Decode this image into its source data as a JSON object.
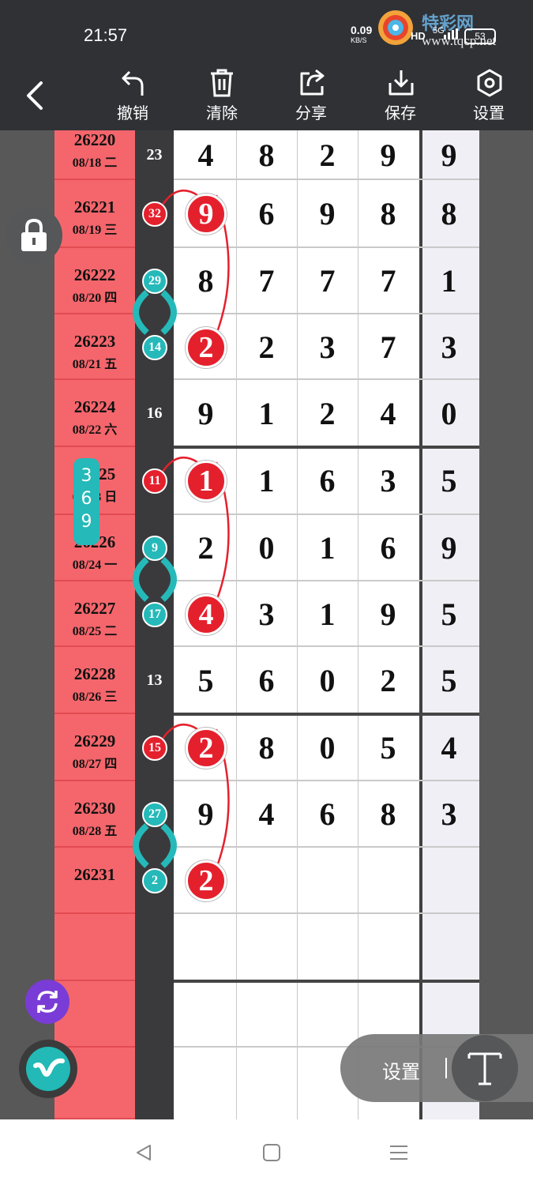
{
  "status_bar": {
    "time": "21:57",
    "net_speed": "0.09",
    "net_unit": "KB/S",
    "hd": "HD",
    "signal": "5G",
    "battery": "53",
    "watermark_text": "特彩网",
    "watermark_url": "www.tqcp.net"
  },
  "toolbar": {
    "back_icon": "back-arrow-icon",
    "tools": [
      {
        "label": "撤销",
        "icon": "undo-icon"
      },
      {
        "label": "清除",
        "icon": "trash-icon"
      },
      {
        "label": "分享",
        "icon": "share-icon"
      },
      {
        "label": "保存",
        "icon": "download-icon"
      },
      {
        "label": "设置",
        "icon": "hexagon-settings-icon"
      }
    ]
  },
  "rows": [
    {
      "id": "26220",
      "date": "08/18 二",
      "sum": "23",
      "digits": [
        "4",
        "8",
        "2",
        "9"
      ],
      "last": "9"
    },
    {
      "id": "26221",
      "date": "08/19 三",
      "sum": "32",
      "digits": [
        "9",
        "6",
        "9",
        "8"
      ],
      "last": "8"
    },
    {
      "id": "26222",
      "date": "08/20 四",
      "sum": "29",
      "digits": [
        "8",
        "7",
        "7",
        "7"
      ],
      "last": "1"
    },
    {
      "id": "26223",
      "date": "08/21 五",
      "sum": "14",
      "digits": [
        "2",
        "2",
        "3",
        "7"
      ],
      "last": "3"
    },
    {
      "id": "26224",
      "date": "08/22 六",
      "sum": "16",
      "digits": [
        "9",
        "1",
        "2",
        "4"
      ],
      "last": "0"
    },
    {
      "id": "26225",
      "date": "08/23 日",
      "sum": "11",
      "digits": [
        "1",
        "1",
        "6",
        "3"
      ],
      "last": "5"
    },
    {
      "id": "26226",
      "date": "08/24 一",
      "sum": "9",
      "digits": [
        "2",
        "0",
        "1",
        "6"
      ],
      "last": "9"
    },
    {
      "id": "26227",
      "date": "08/25 二",
      "sum": "17",
      "digits": [
        "4",
        "3",
        "1",
        "9"
      ],
      "last": "5"
    },
    {
      "id": "26228",
      "date": "08/26 三",
      "sum": "13",
      "digits": [
        "5",
        "6",
        "0",
        "2"
      ],
      "last": "5"
    },
    {
      "id": "26229",
      "date": "08/27 四",
      "sum": "15",
      "digits": [
        "2",
        "8",
        "0",
        "5"
      ],
      "last": "4"
    },
    {
      "id": "26230",
      "date": "08/28 五",
      "sum": "27",
      "digits": [
        "9",
        "4",
        "6",
        "8"
      ],
      "last": "3"
    },
    {
      "id": "26231",
      "date": "",
      "sum": "2",
      "digits": [
        "2",
        "",
        "",
        ""
      ],
      "last": ""
    }
  ],
  "floating": {
    "label_369": [
      "3",
      "6",
      "9"
    ],
    "settings_label": "设置",
    "lock_icon": "lock-icon",
    "refresh_icon": "refresh-icon",
    "text_tool_icon": "text-tool-icon",
    "app_icon": "app-logo-icon"
  },
  "colors": {
    "period_bg": "#f4666c",
    "red_mark": "#e5202d",
    "teal_mark": "#25b9b9",
    "toolbar_bg": "#2f3135"
  },
  "navbar": {
    "back_icon": "nav-back-triangle-icon",
    "home_icon": "nav-home-square-icon",
    "menu_icon": "nav-menu-icon"
  }
}
